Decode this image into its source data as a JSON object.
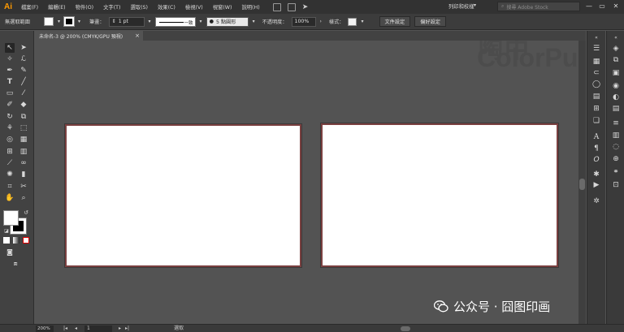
{
  "app": {
    "logo": "Ai"
  },
  "menu": [
    "檔案(F)",
    "編輯(E)",
    "物件(O)",
    "文字(T)",
    "選取(S)",
    "效果(C)",
    "檢視(V)",
    "視窗(W)",
    "說明(H)"
  ],
  "workspace": {
    "label": "列印和校樣",
    "caret": "▾"
  },
  "search": {
    "placeholder": "搜尋 Adobe Stock"
  },
  "window_controls": {
    "minimize": "—",
    "restore": "▭",
    "close": "✕"
  },
  "control_bar": {
    "selection_label": "無選取範圍",
    "stroke_label": "筆畫：",
    "stroke_weight": "1 pt",
    "stroke_profile": "一致",
    "brush": "5 點圓形",
    "opacity_label": "不透明度：",
    "opacity_value": "100%",
    "style_label": "樣式：",
    "doc_setup_button": "文件設定",
    "prefs_button": "偏好設定"
  },
  "document_tab": {
    "title": "未命名-3 @ 200% (CMYK/GPU 預視)",
    "close": "×"
  },
  "watermark": {
    "chinese": "陶中",
    "english": "ColorPu"
  },
  "attribution": {
    "text": "公众号 · 囧图印画"
  },
  "status_bar": {
    "zoom": "200%",
    "page": "1",
    "tool": "選取"
  },
  "colors": {
    "artboard_border": "#7a4040",
    "logo": "#ff9a00",
    "canvas": "#535353"
  }
}
